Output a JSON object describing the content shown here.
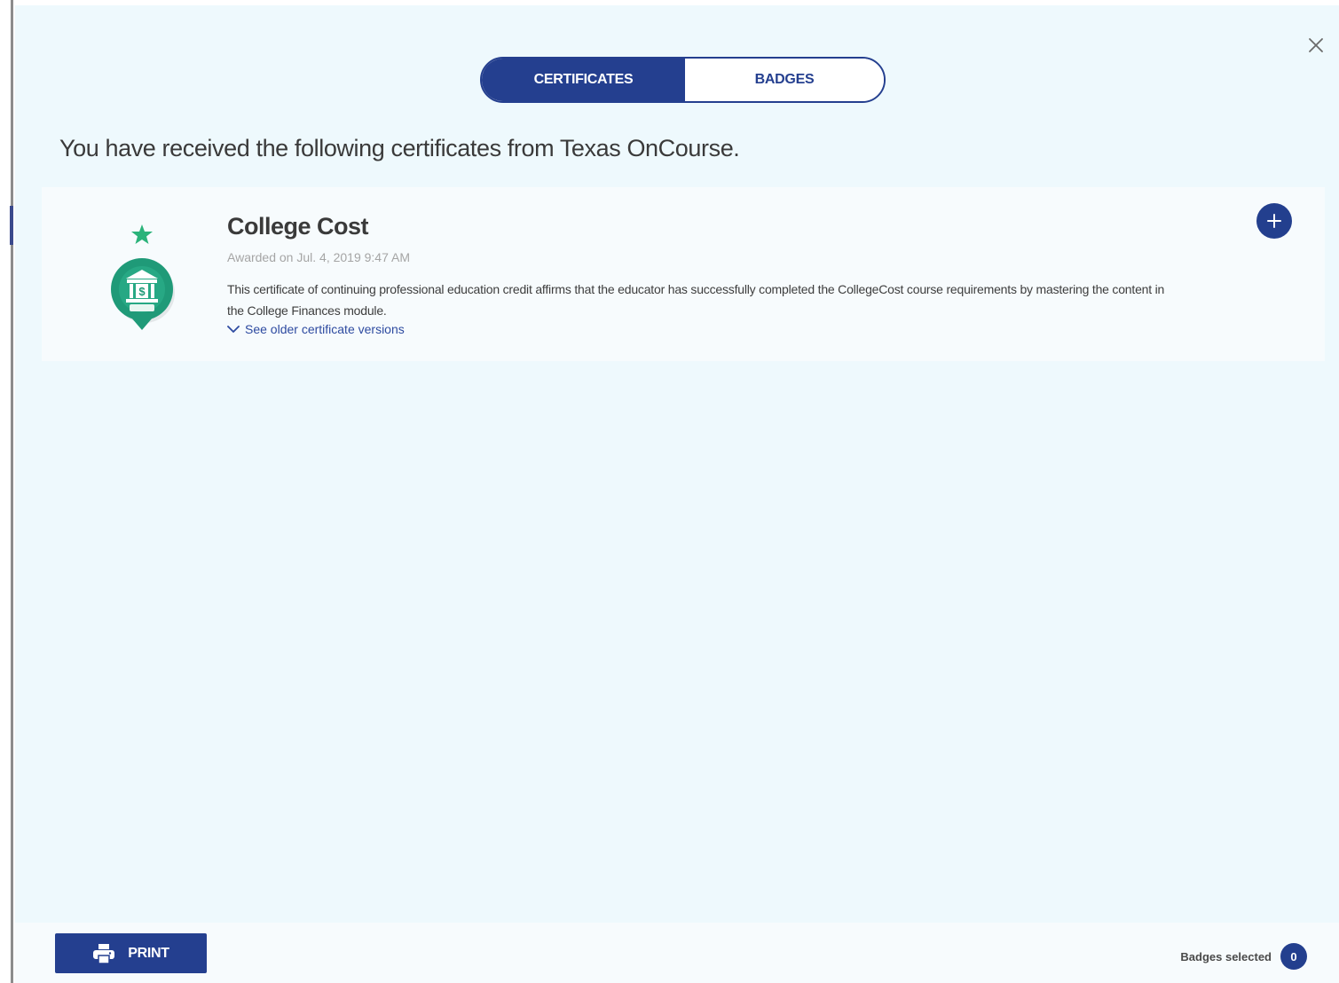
{
  "dialog": {
    "close_label": "×"
  },
  "tabs": [
    {
      "label": "CERTIFICATES",
      "active": true
    },
    {
      "label": "BADGES",
      "active": false
    }
  ],
  "intro_text": "You have received the following certificates from Texas OnCourse.",
  "certificates": [
    {
      "title": "College Cost",
      "awarded": "Awarded on Jul. 4, 2019 9:47 AM",
      "description": "This certificate of continuing professional education credit affirms that the educator has successfully completed the CollegeCost course requirements by mastering the content in the College Finances module.",
      "older_link": "See older certificate versions",
      "icon": "bank-badge-icon",
      "star_icon": "star-icon",
      "add_icon": "plus-icon"
    }
  ],
  "footer": {
    "print_label": "PRINT",
    "badges_selected_label": "Badges selected",
    "badges_selected_count": "0"
  },
  "colors": {
    "primary": "#243f8f",
    "background": "#eef9fd",
    "card": "#f7fbfd",
    "badge_green": "#1f9a78",
    "star_green": "#2bb37a"
  }
}
